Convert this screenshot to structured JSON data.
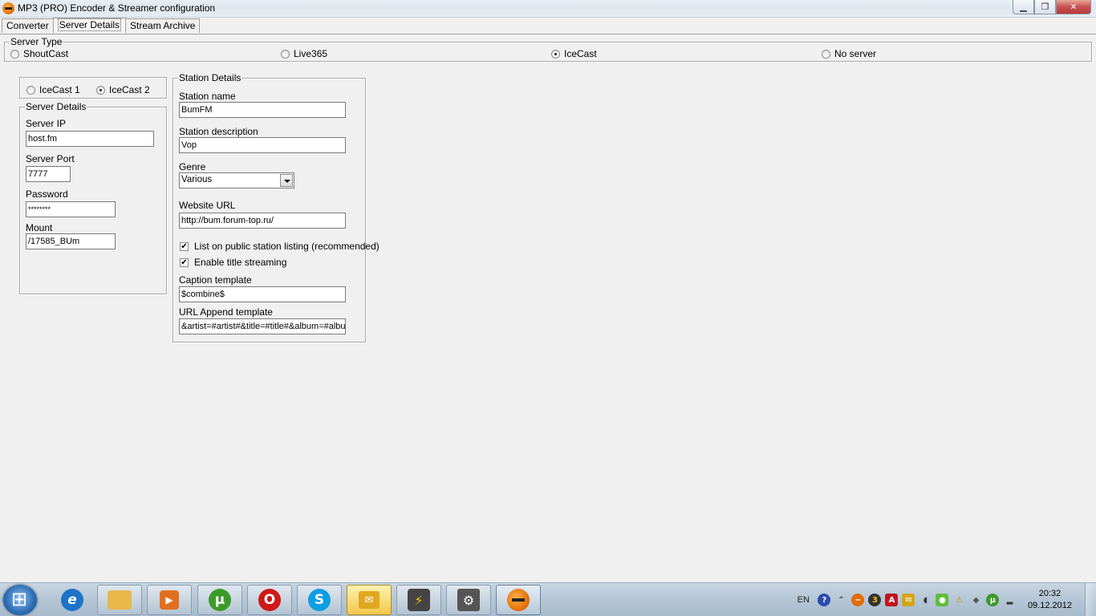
{
  "window": {
    "title": "MP3 (PRO) Encoder & Streamer configuration",
    "minimize": "▁",
    "maximize": "❐",
    "close": "✕"
  },
  "tabs": [
    {
      "label": "Converter",
      "active": false
    },
    {
      "label": "Server Details",
      "active": true
    },
    {
      "label": "Stream Archive",
      "active": false
    }
  ],
  "server_type": {
    "legend": "Server Type",
    "options": [
      {
        "label": "ShoutCast",
        "checked": false
      },
      {
        "label": "Live365",
        "checked": false
      },
      {
        "label": "IceCast",
        "checked": true
      },
      {
        "label": "No server",
        "checked": false
      }
    ]
  },
  "icecast_version": {
    "options": [
      {
        "label": "IceCast 1",
        "checked": false
      },
      {
        "label": "IceCast 2",
        "checked": true
      }
    ]
  },
  "server_details": {
    "legend": "Server Details",
    "ip_label": "Server IP",
    "ip_value": "host.fm",
    "port_label": "Server Port",
    "port_value": "7777",
    "password_label": "Password",
    "password_value": "********",
    "mount_label": "Mount",
    "mount_value": "/17585_BUm"
  },
  "station_details": {
    "legend": "Station Details",
    "name_label": "Station name",
    "name_value": "BumFM",
    "desc_label": "Station description",
    "desc_value": "Vop",
    "genre_label": "Genre",
    "genre_value": "Various",
    "url_label": "Website URL",
    "url_value": "http://bum.forum-top.ru/",
    "public_listing_label": "List on public station listing (recommended)",
    "public_listing_checked": true,
    "title_streaming_label": "Enable title streaming",
    "title_streaming_checked": true,
    "caption_label": "Caption template",
    "caption_value": "$combine$",
    "url_append_label": "URL Append template",
    "url_append_value": "&artist=#artist#&title=#title#&album=#album#"
  },
  "taskbar": {
    "apps": [
      {
        "name": "internet-explorer",
        "color": "#1e73c8"
      },
      {
        "name": "file-explorer",
        "color": "#e8b84a"
      },
      {
        "name": "media-player",
        "color": "#e07020"
      },
      {
        "name": "utorrent",
        "color": "#3c9a2a"
      },
      {
        "name": "opera",
        "color": "#d01818"
      },
      {
        "name": "skype",
        "color": "#0e9ee2"
      },
      {
        "name": "mail-agent",
        "color": "#e0a820"
      },
      {
        "name": "winamp",
        "color": "#444444"
      },
      {
        "name": "settings-app",
        "color": "#555555"
      },
      {
        "name": "mp3-encoder",
        "color": "#e26a00"
      }
    ],
    "tray": {
      "language": "EN",
      "time": "20:32",
      "date": "09.12.2012"
    }
  }
}
